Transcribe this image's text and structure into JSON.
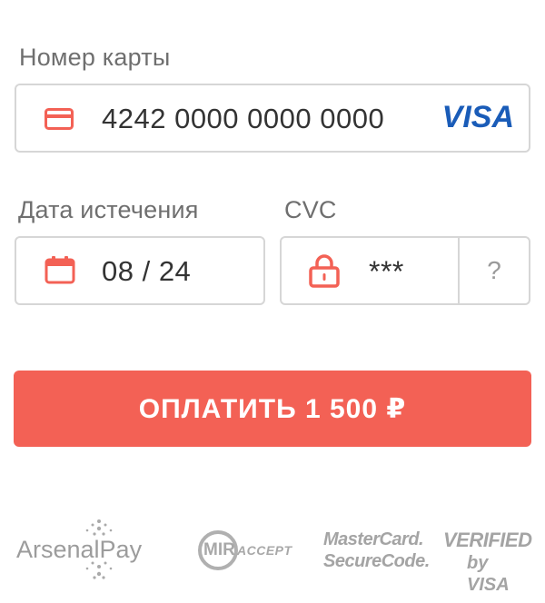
{
  "card": {
    "label": "Номер карты",
    "number": "4242 0000 0000 0000",
    "brand": "VISA"
  },
  "expiry": {
    "label": "Дата истечения",
    "value": "08 / 24"
  },
  "cvc": {
    "label": "CVC",
    "value": "***",
    "help": "?"
  },
  "pay_button": {
    "label": "ОПЛАТИТЬ 1 500 ₽"
  },
  "logos": {
    "arsenalpay": "ArsenalPay",
    "mir_accept_mark": "MIR",
    "mir_accept_word": "ACCEPT",
    "mastercard_line1": "MasterCard.",
    "mastercard_line2": "SecureCode.",
    "verified_line1": "VERIFIED",
    "verified_line2": "by VISA"
  },
  "colors": {
    "accent": "#f36155",
    "visa_blue": "#1a5cb8",
    "border": "#d6d6d6",
    "label": "#6f6f6f",
    "logo_gray": "#9c9c9c"
  },
  "icons": {
    "card": "credit-card-icon",
    "calendar": "calendar-icon",
    "lock": "lock-icon"
  }
}
